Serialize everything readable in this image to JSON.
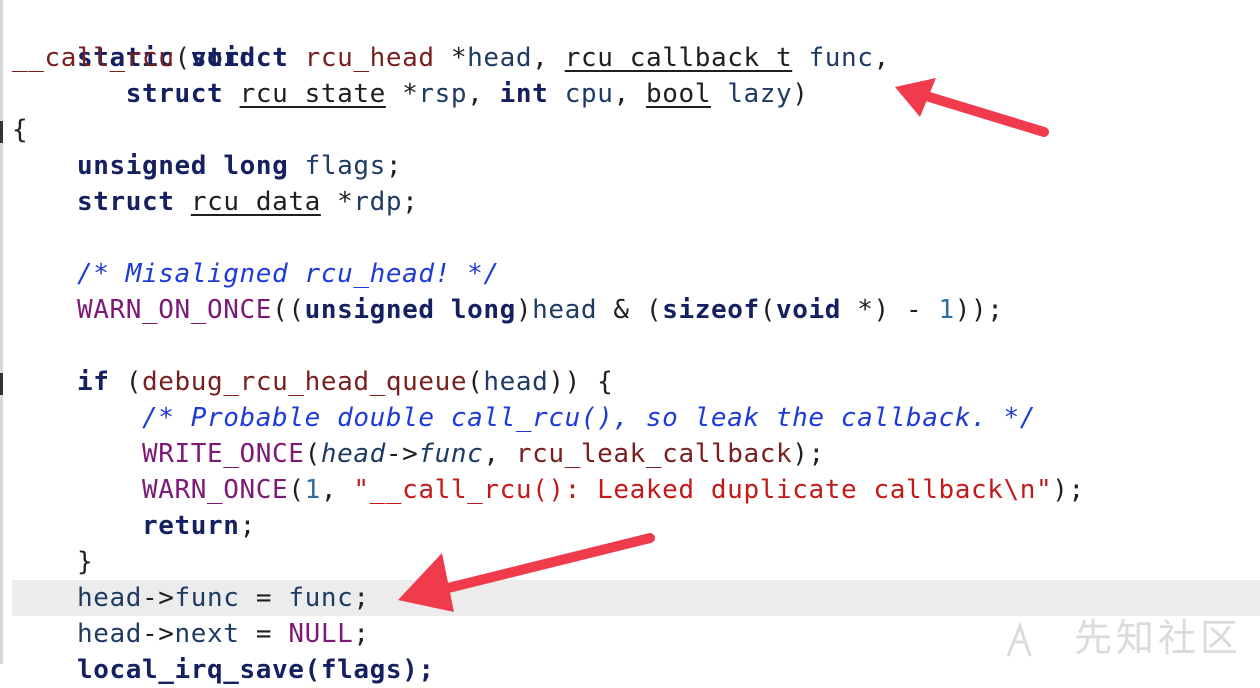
{
  "code": {
    "l1": {
      "a": "static void"
    },
    "l2": {
      "fn": "__call_rcu",
      "p1": "(",
      "k1": "struct",
      "t1": "rcu_head",
      "s1": " *",
      "i1": "head",
      "c1": ", ",
      "t2": "rcu_callback_t",
      "s2": " ",
      "i2": "func",
      "c2": ","
    },
    "l3": {
      "k1": "struct",
      "t1": "rcu_state",
      "s1": " *",
      "i1": "rsp",
      "c1": ", ",
      "k2": "int",
      "i2": "cpu",
      "c2": ", ",
      "t2": "bool",
      "i3": "lazy",
      "p": ")"
    },
    "l4": {
      "a": "{"
    },
    "l5": {
      "k1": "unsigned",
      "k2": "long",
      "i1": "flags",
      "p": ";"
    },
    "l6": {
      "k1": "struct",
      "t1": "rcu_data",
      "s1": " *",
      "i1": "rdp",
      "p": ";"
    },
    "l8": {
      "cm": "/* Misaligned rcu_head! */"
    },
    "l9": {
      "mac": "WARN_ON_ONCE",
      "p1": "((",
      "k1": "unsigned",
      "k2": "long",
      "p2": ")",
      "i1": "head",
      "p3": " & (",
      "k3": "sizeof",
      "p4": "(",
      "k4": "void",
      "p5": " *) - ",
      "n1": "1",
      "p6": "));"
    },
    "l11": {
      "k1": "if",
      "p1": " (",
      "fn": "debug_rcu_head_queue",
      "p2": "(",
      "i1": "head",
      "p3": ")) {"
    },
    "l12": {
      "cm": "/* Probable double call_rcu(), so leak the callback. */"
    },
    "l13": {
      "mac": "WRITE_ONCE",
      "p1": "(",
      "it1": "head",
      "p2": "->",
      "it2": "func",
      "p3": ", ",
      "fn": "rcu_leak_callback",
      "p4": ");"
    },
    "l14": {
      "mac": "WARN_ONCE",
      "p1": "(",
      "n1": "1",
      "p2": ", ",
      "str": "\"__call_rcu(): Leaked duplicate callback\\n\"",
      "p3": ");"
    },
    "l15": {
      "k1": "return",
      "p": ";"
    },
    "l16": {
      "a": "}"
    },
    "l17": {
      "i1": "head",
      "p1": "->",
      "i2": "func",
      "p2": " = ",
      "i3": "func",
      "p3": ";"
    },
    "l18": {
      "i1": "head",
      "p1": "->",
      "i2": "next",
      "p2": " = ",
      "mac": "NULL",
      "p3": ";"
    },
    "l19": {
      "a": "local_irq_save(flags);"
    }
  },
  "colors": {
    "keyword": "#14205f",
    "function": "#7a1f1f",
    "comment": "#1f3bd6",
    "macro": "#7d1a75",
    "string": "#c21a1a",
    "arrow": "#ef3b4b",
    "highlight": "#ececec"
  },
  "watermark": {
    "text": "先知社区"
  }
}
